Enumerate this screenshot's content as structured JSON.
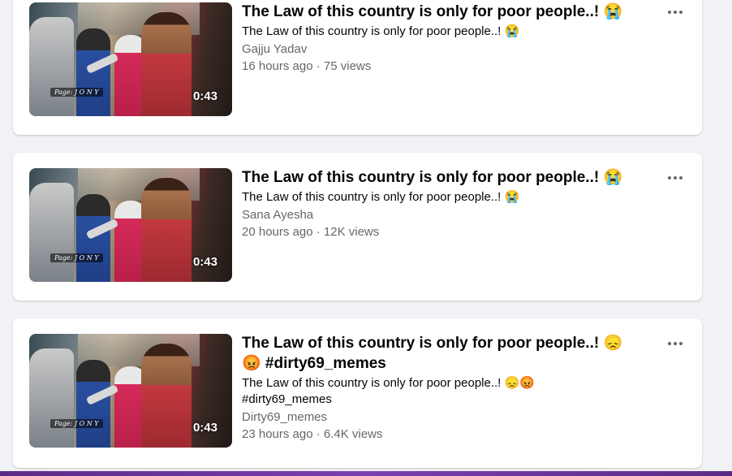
{
  "videos": [
    {
      "duration": "0:43",
      "watermark": "Page: J O N Y",
      "title": "The Law of this country is only for poor people..! 😭",
      "description": "The Law of this country is only for poor people..! 😭",
      "author": "Gajju Yadav",
      "meta": "16 hours ago · 75 views"
    },
    {
      "duration": "0:43",
      "watermark": "Page: J O N Y",
      "title": "The Law of this country is only for poor people..! 😭",
      "description": "The Law of this country is only for poor people..! 😭",
      "author": "Sana Ayesha",
      "meta": "20 hours ago · 12K views"
    },
    {
      "duration": "0:43",
      "watermark": "Page: J O N Y",
      "title": "The Law of this country is only for poor people..! 😞😡 #dirty69_memes",
      "description": "The Law of this country is only for poor people..! 😞😡 #dirty69_memes",
      "author": "Dirty69_memes",
      "meta": "23 hours ago · 6.4K views"
    }
  ],
  "icons": {
    "more": "more-options-icon"
  },
  "colors": {
    "secondary_text": "#65676b",
    "card_bg": "#ffffff",
    "page_bg": "#f0f2f5",
    "bottom_bar": "#7b3fb0"
  }
}
